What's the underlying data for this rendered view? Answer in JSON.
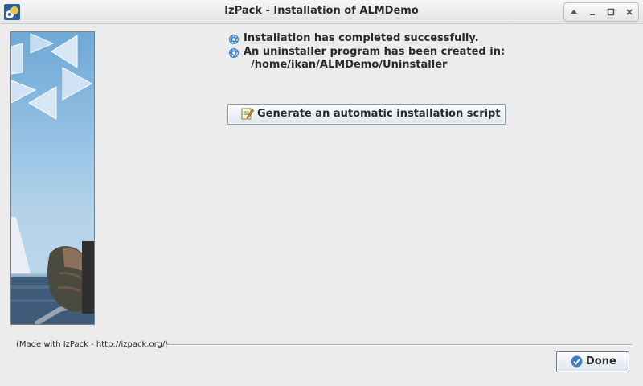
{
  "window": {
    "title": "IzPack - Installation of ALMDemo",
    "buttons": [
      "restore",
      "minimize",
      "maximize",
      "close"
    ]
  },
  "messages": {
    "line1": "Installation has completed successfully.",
    "line2": "An uninstaller program has been created in:",
    "path": "/home/ikan/ALMDemo/Uninstaller"
  },
  "actions": {
    "generate_script_label": "Generate an automatic installation script",
    "done_label": "Done"
  },
  "footer": {
    "made_with": "(Made with IzPack - http://izpack.org/)"
  },
  "icons": {
    "app": "izpack-app-icon",
    "info": "gear-bullet-icon",
    "script": "edit-script-icon",
    "done": "check-circle-icon"
  },
  "colors": {
    "background": "#ececec",
    "accent": "#3a7fc4",
    "text": "#2a2a2a"
  }
}
